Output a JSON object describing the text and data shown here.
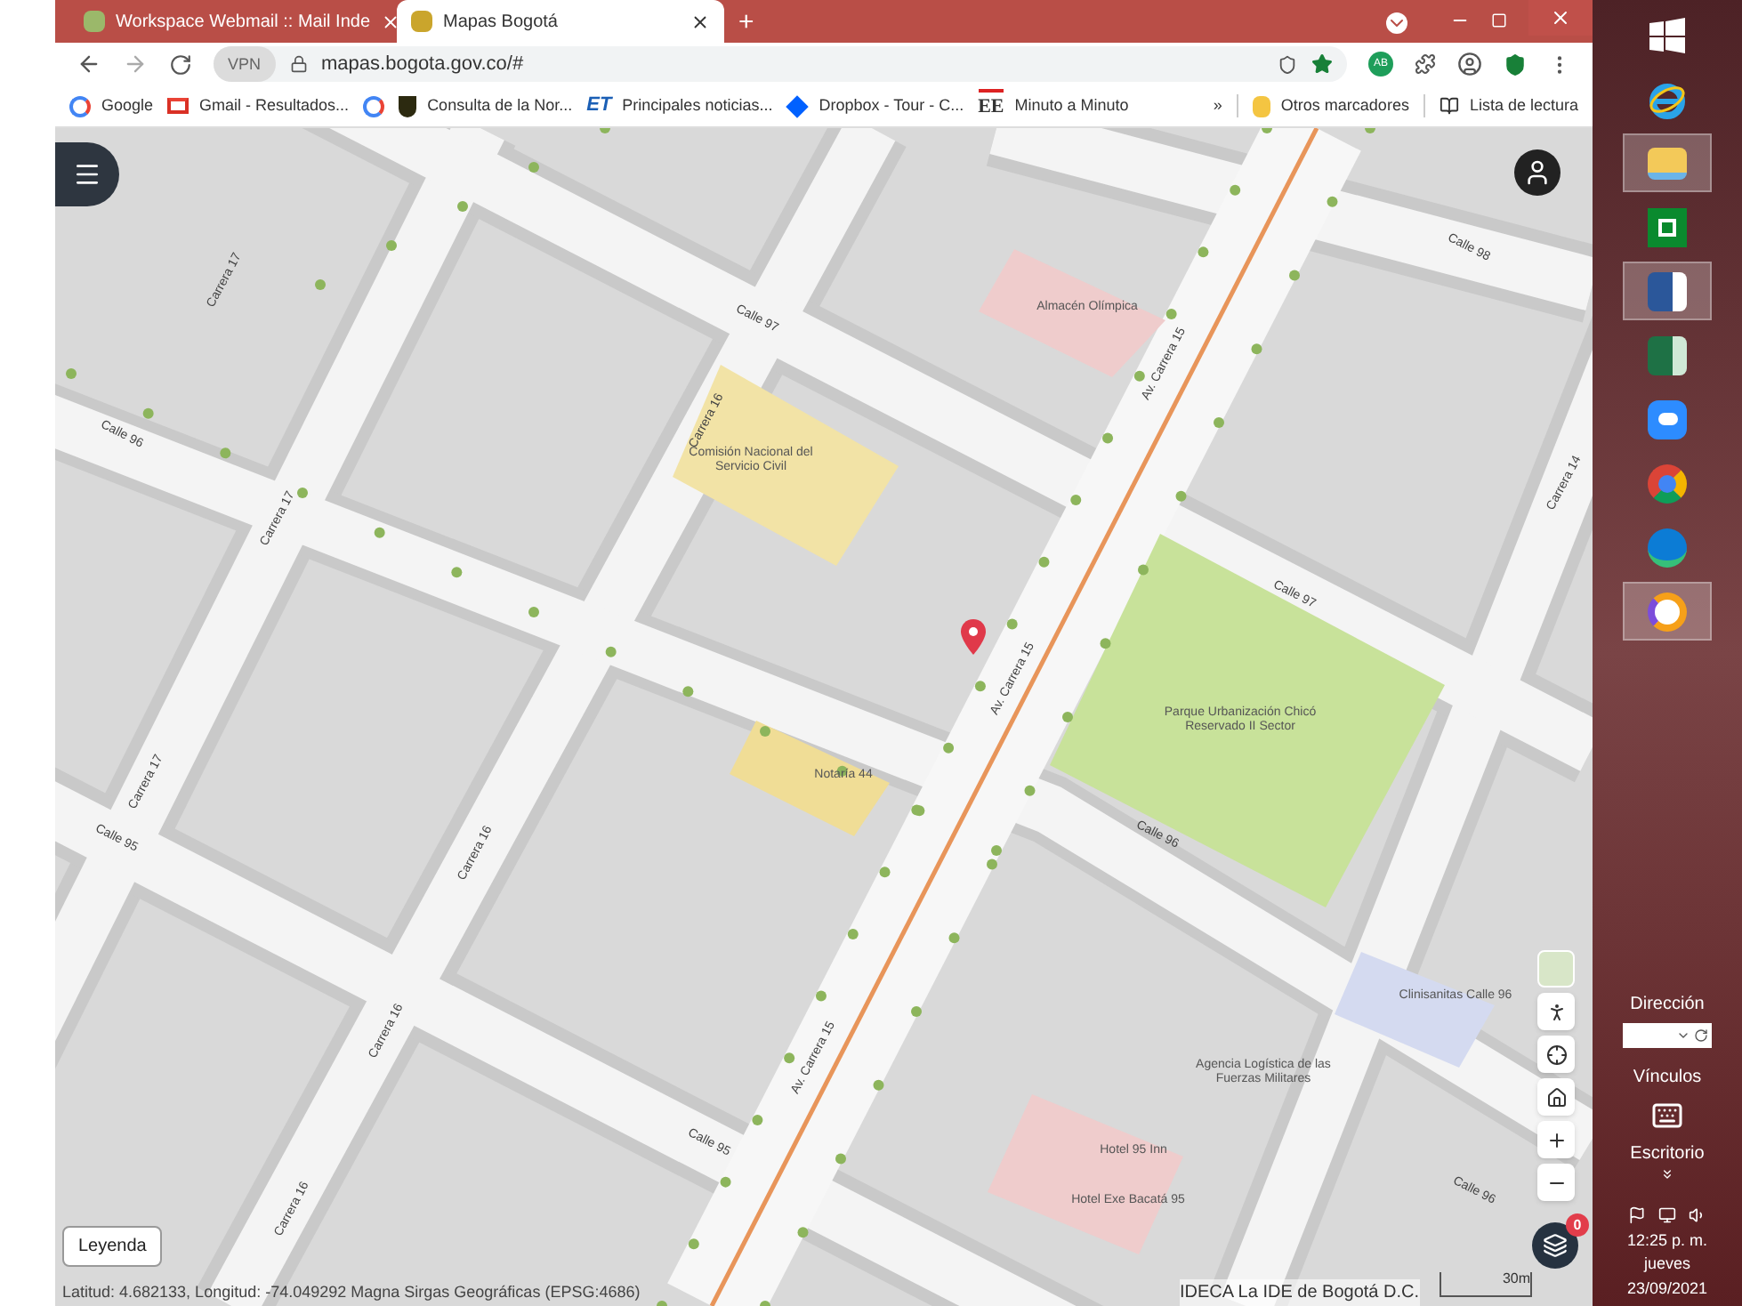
{
  "browser": {
    "tabs": [
      {
        "title": "Workspace Webmail :: Mail Inde",
        "selected": false
      },
      {
        "title": "Mapas Bogotá",
        "selected": true
      }
    ],
    "new_tab": "+",
    "vpn": "VPN",
    "address": "mapas.bogota.gov.co/#",
    "bookmarks": [
      {
        "kind": "google",
        "label": "Google"
      },
      {
        "kind": "gmail",
        "label": "Gmail - Resultados..."
      },
      {
        "kind": "google"
      },
      {
        "kind": "crest",
        "label": "Consulta de la Nor..."
      },
      {
        "kind": "et",
        "logo": "ET",
        "label": "Principales noticias..."
      },
      {
        "kind": "dropbox",
        "label": "Dropbox - Tour - C..."
      },
      {
        "kind": "ee",
        "logo": "EE",
        "label": "Minuto a Minuto"
      }
    ],
    "overflow": "»",
    "other_bookmarks": "Otros marcadores",
    "reading_list": "Lista de lectura",
    "extension_badge": "AB"
  },
  "map": {
    "labels": [
      {
        "kind": "descending",
        "text": "Calle 97"
      },
      {
        "kind": "ascending",
        "text": "Carrera 16"
      },
      {
        "kind": "descending",
        "text": "Calle 98"
      },
      {
        "kind": "place",
        "text": "Almacén Olímpica"
      },
      {
        "kind": "ascending",
        "text": "Av. Carrera 15"
      },
      {
        "kind": "place",
        "text": "Comisión Nacional del Servicio Civil"
      },
      {
        "kind": "ascending",
        "text": "Carrera 14"
      },
      {
        "kind": "descending",
        "text": "Calle 96"
      },
      {
        "kind": "ascending",
        "text": "Carrera 17"
      },
      {
        "kind": "ascending",
        "text": "Carrera 17"
      },
      {
        "kind": "descending",
        "text": "Calle 97"
      },
      {
        "kind": "ascending",
        "text": "Av. Carrera 15"
      },
      {
        "kind": "place",
        "text": "Parque Urbanización Chicó Reservado II Sector"
      },
      {
        "kind": "place",
        "text": "Notaría 44"
      },
      {
        "kind": "ascending",
        "text": "Carrera 17"
      },
      {
        "kind": "descending",
        "text": "Calle 95"
      },
      {
        "kind": "ascending",
        "text": "Carrera 16"
      },
      {
        "kind": "descending",
        "text": "Calle 96"
      },
      {
        "kind": "place",
        "text": "Clinisanitas Calle 96"
      },
      {
        "kind": "ascending",
        "text": "Carrera 16"
      },
      {
        "kind": "place",
        "text": "Agencia Logística de las Fuerzas Militares"
      },
      {
        "kind": "ascending",
        "text": "Av. Carrera 15"
      },
      {
        "kind": "descending",
        "text": "Calle 95"
      },
      {
        "kind": "place",
        "text": "Hotel 95 Inn"
      },
      {
        "kind": "place",
        "text": "Hotel Exe Bacatá 95"
      },
      {
        "kind": "ascending",
        "text": "Carrera 16"
      },
      {
        "kind": "descending",
        "text": "Calle 96"
      }
    ],
    "layers_badge": "0",
    "legend": "Leyenda",
    "coordinates": "Latitud: 4.682133, Longitud: -74.049292 Magna Sirgas Geográficas (EPSG:4686)",
    "attribution": "IDECA La IDE de Bogotá D.C.",
    "scale": "30m"
  },
  "taskbar": {
    "apps": [
      {
        "kind": "start",
        "selected": false
      },
      {
        "kind": "ie",
        "selected": false
      },
      {
        "kind": "explorer",
        "selected": true
      },
      {
        "kind": "store",
        "selected": false
      },
      {
        "kind": "word",
        "selected": true
      },
      {
        "kind": "excel",
        "selected": false
      },
      {
        "kind": "video",
        "selected": false
      },
      {
        "kind": "chrome",
        "selected": false
      },
      {
        "kind": "edge",
        "selected": false
      },
      {
        "kind": "secure",
        "selected": true
      }
    ],
    "address_label": "Dirección",
    "links_label": "Vínculos",
    "desktop_label": "Escritorio",
    "time": "12:25 p. m.",
    "day": "jueves",
    "date": "23/09/2021"
  }
}
